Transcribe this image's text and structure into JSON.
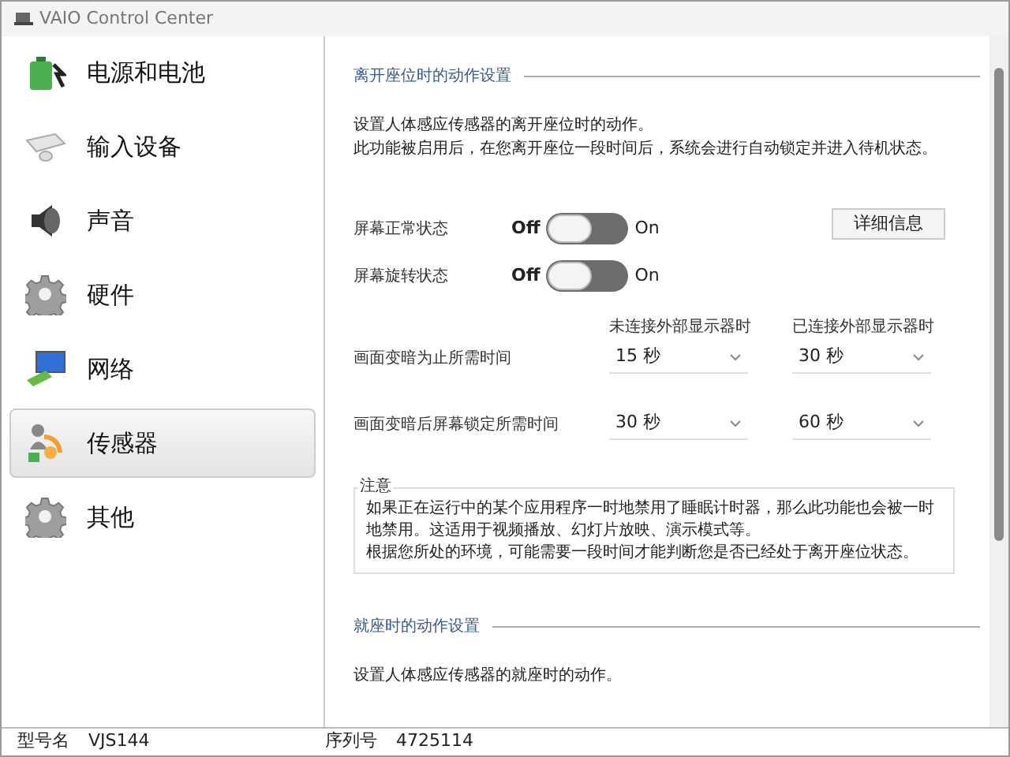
{
  "window": {
    "title": "VAIO Control Center"
  },
  "sidebar": {
    "items": [
      {
        "label": "电源和电池",
        "kind": "battery",
        "selected": false
      },
      {
        "label": "输入设备",
        "kind": "keyboard",
        "selected": false
      },
      {
        "label": "声音",
        "kind": "speaker",
        "selected": false
      },
      {
        "label": "硬件",
        "kind": "gear",
        "selected": false
      },
      {
        "label": "网络",
        "kind": "network",
        "selected": false
      },
      {
        "label": "传感器",
        "kind": "sensor",
        "selected": true
      },
      {
        "label": "其他",
        "kind": "gear",
        "selected": false
      }
    ]
  },
  "away_section": {
    "title": "离开座位时的动作设置",
    "description": [
      "设置人体感应传感器的离开座位时的动作。",
      "此功能被启用后，在您离开座位一段时间后，系统会进行自动锁定并进入待机状态。"
    ],
    "toggles": [
      {
        "label": "屏幕正常状态",
        "off_label": "Off",
        "on_label": "On",
        "on": false
      },
      {
        "label": "屏幕旋转状态",
        "off_label": "Off",
        "on_label": "On",
        "on": false
      }
    ],
    "details_button": "详细信息",
    "column_headers": [
      "未连接外部显示器时",
      "已连接外部显示器时"
    ],
    "rows": [
      {
        "label": "画面变暗为止所需时间",
        "values": [
          "15 秒",
          "30 秒"
        ]
      },
      {
        "label": "画面变暗后屏幕锁定所需时间",
        "values": [
          "30 秒",
          "60 秒"
        ]
      }
    ],
    "note": {
      "title": "注意",
      "lines": [
        "如果正在运行中的某个应用程序一时地禁用了睡眠计时器，那么此功能也会被一时地禁用。这适用于视频播放、幻灯片放映、演示模式等。",
        "根据您所处的环境，可能需要一段时间才能判断您是否已经处于离开座位状态。"
      ]
    }
  },
  "seated_section": {
    "title": "就座时的动作设置",
    "description": [
      "设置人体感应传感器的就座时的动作。"
    ]
  },
  "status_bar": {
    "model_label": "型号名",
    "model": "VJS144",
    "serial_label": "序列号",
    "serial": "4725114"
  }
}
